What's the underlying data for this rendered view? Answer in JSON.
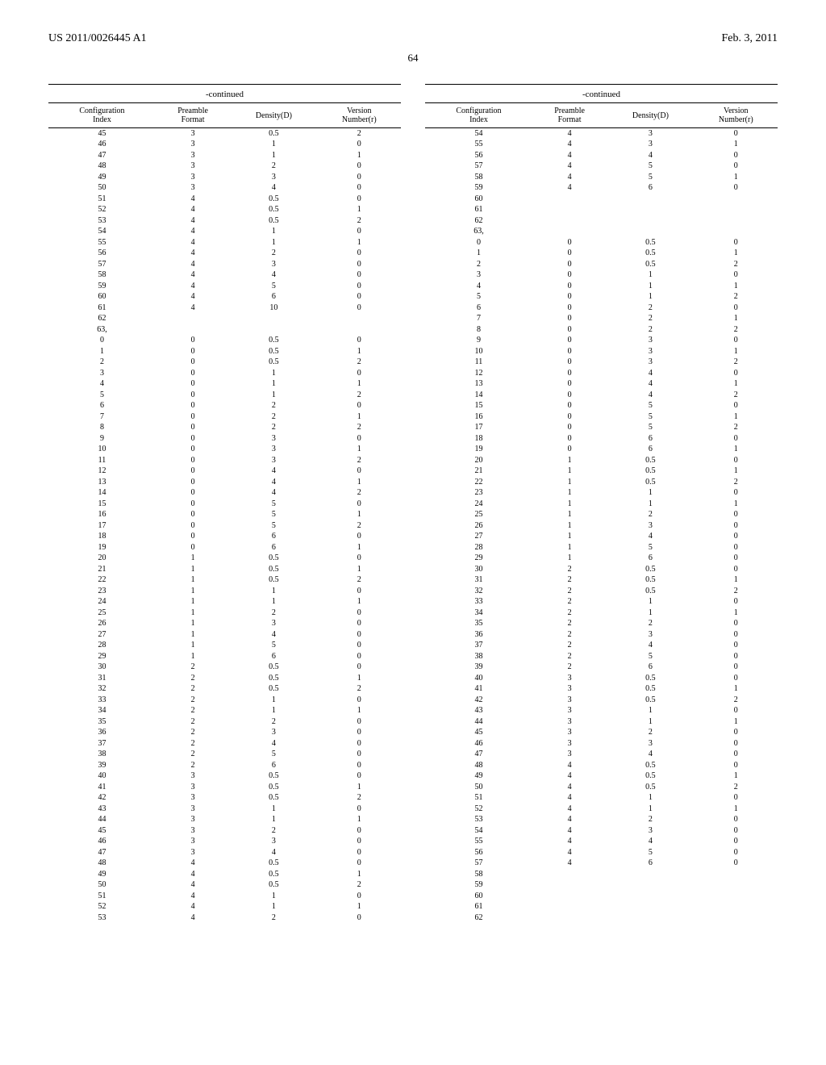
{
  "header": {
    "pub_number": "US 2011/0026445 A1",
    "pub_date": "Feb. 3, 2011",
    "page_number": "64"
  },
  "table": {
    "title": "-continued",
    "headers": [
      "Configuration\nIndex",
      "Preamble\nFormat",
      "Density(D)",
      "Version\nNumber(r)"
    ]
  },
  "left_rows": [
    [
      "45",
      "3",
      "0.5",
      "2"
    ],
    [
      "46",
      "3",
      "1",
      "0"
    ],
    [
      "47",
      "3",
      "1",
      "1"
    ],
    [
      "48",
      "3",
      "2",
      "0"
    ],
    [
      "49",
      "3",
      "3",
      "0"
    ],
    [
      "50",
      "3",
      "4",
      "0"
    ],
    [
      "51",
      "4",
      "0.5",
      "0"
    ],
    [
      "52",
      "4",
      "0.5",
      "1"
    ],
    [
      "53",
      "4",
      "0.5",
      "2"
    ],
    [
      "54",
      "4",
      "1",
      "0"
    ],
    [
      "55",
      "4",
      "1",
      "1"
    ],
    [
      "56",
      "4",
      "2",
      "0"
    ],
    [
      "57",
      "4",
      "3",
      "0"
    ],
    [
      "58",
      "4",
      "4",
      "0"
    ],
    [
      "59",
      "4",
      "5",
      "0"
    ],
    [
      "60",
      "4",
      "6",
      "0"
    ],
    [
      "61",
      "4",
      "10",
      "0"
    ],
    [
      "62",
      "",
      "",
      ""
    ],
    [
      "63,",
      "",
      "",
      ""
    ],
    [
      "0",
      "0",
      "0.5",
      "0"
    ],
    [
      "1",
      "0",
      "0.5",
      "1"
    ],
    [
      "2",
      "0",
      "0.5",
      "2"
    ],
    [
      "3",
      "0",
      "1",
      "0"
    ],
    [
      "4",
      "0",
      "1",
      "1"
    ],
    [
      "5",
      "0",
      "1",
      "2"
    ],
    [
      "6",
      "0",
      "2",
      "0"
    ],
    [
      "7",
      "0",
      "2",
      "1"
    ],
    [
      "8",
      "0",
      "2",
      "2"
    ],
    [
      "9",
      "0",
      "3",
      "0"
    ],
    [
      "10",
      "0",
      "3",
      "1"
    ],
    [
      "11",
      "0",
      "3",
      "2"
    ],
    [
      "12",
      "0",
      "4",
      "0"
    ],
    [
      "13",
      "0",
      "4",
      "1"
    ],
    [
      "14",
      "0",
      "4",
      "2"
    ],
    [
      "15",
      "0",
      "5",
      "0"
    ],
    [
      "16",
      "0",
      "5",
      "1"
    ],
    [
      "17",
      "0",
      "5",
      "2"
    ],
    [
      "18",
      "0",
      "6",
      "0"
    ],
    [
      "19",
      "0",
      "6",
      "1"
    ],
    [
      "20",
      "1",
      "0.5",
      "0"
    ],
    [
      "21",
      "1",
      "0.5",
      "1"
    ],
    [
      "22",
      "1",
      "0.5",
      "2"
    ],
    [
      "23",
      "1",
      "1",
      "0"
    ],
    [
      "24",
      "1",
      "1",
      "1"
    ],
    [
      "25",
      "1",
      "2",
      "0"
    ],
    [
      "26",
      "1",
      "3",
      "0"
    ],
    [
      "27",
      "1",
      "4",
      "0"
    ],
    [
      "28",
      "1",
      "5",
      "0"
    ],
    [
      "29",
      "1",
      "6",
      "0"
    ],
    [
      "30",
      "2",
      "0.5",
      "0"
    ],
    [
      "31",
      "2",
      "0.5",
      "1"
    ],
    [
      "32",
      "2",
      "0.5",
      "2"
    ],
    [
      "33",
      "2",
      "1",
      "0"
    ],
    [
      "34",
      "2",
      "1",
      "1"
    ],
    [
      "35",
      "2",
      "2",
      "0"
    ],
    [
      "36",
      "2",
      "3",
      "0"
    ],
    [
      "37",
      "2",
      "4",
      "0"
    ],
    [
      "38",
      "2",
      "5",
      "0"
    ],
    [
      "39",
      "2",
      "6",
      "0"
    ],
    [
      "40",
      "3",
      "0.5",
      "0"
    ],
    [
      "41",
      "3",
      "0.5",
      "1"
    ],
    [
      "42",
      "3",
      "0.5",
      "2"
    ],
    [
      "43",
      "3",
      "1",
      "0"
    ],
    [
      "44",
      "3",
      "1",
      "1"
    ],
    [
      "45",
      "3",
      "2",
      "0"
    ],
    [
      "46",
      "3",
      "3",
      "0"
    ],
    [
      "47",
      "3",
      "4",
      "0"
    ],
    [
      "48",
      "4",
      "0.5",
      "0"
    ],
    [
      "49",
      "4",
      "0.5",
      "1"
    ],
    [
      "50",
      "4",
      "0.5",
      "2"
    ],
    [
      "51",
      "4",
      "1",
      "0"
    ],
    [
      "52",
      "4",
      "1",
      "1"
    ],
    [
      "53",
      "4",
      "2",
      "0"
    ]
  ],
  "right_rows": [
    [
      "54",
      "4",
      "3",
      "0"
    ],
    [
      "55",
      "4",
      "3",
      "1"
    ],
    [
      "56",
      "4",
      "4",
      "0"
    ],
    [
      "57",
      "4",
      "5",
      "0"
    ],
    [
      "58",
      "4",
      "5",
      "1"
    ],
    [
      "59",
      "4",
      "6",
      "0"
    ],
    [
      "60",
      "",
      "",
      ""
    ],
    [
      "61",
      "",
      "",
      ""
    ],
    [
      "62",
      "",
      "",
      ""
    ],
    [
      "63,",
      "",
      "",
      ""
    ],
    [
      "0",
      "0",
      "0.5",
      "0"
    ],
    [
      "1",
      "0",
      "0.5",
      "1"
    ],
    [
      "2",
      "0",
      "0.5",
      "2"
    ],
    [
      "3",
      "0",
      "1",
      "0"
    ],
    [
      "4",
      "0",
      "1",
      "1"
    ],
    [
      "5",
      "0",
      "1",
      "2"
    ],
    [
      "6",
      "0",
      "2",
      "0"
    ],
    [
      "7",
      "0",
      "2",
      "1"
    ],
    [
      "8",
      "0",
      "2",
      "2"
    ],
    [
      "9",
      "0",
      "3",
      "0"
    ],
    [
      "10",
      "0",
      "3",
      "1"
    ],
    [
      "11",
      "0",
      "3",
      "2"
    ],
    [
      "12",
      "0",
      "4",
      "0"
    ],
    [
      "13",
      "0",
      "4",
      "1"
    ],
    [
      "14",
      "0",
      "4",
      "2"
    ],
    [
      "15",
      "0",
      "5",
      "0"
    ],
    [
      "16",
      "0",
      "5",
      "1"
    ],
    [
      "17",
      "0",
      "5",
      "2"
    ],
    [
      "18",
      "0",
      "6",
      "0"
    ],
    [
      "19",
      "0",
      "6",
      "1"
    ],
    [
      "20",
      "1",
      "0.5",
      "0"
    ],
    [
      "21",
      "1",
      "0.5",
      "1"
    ],
    [
      "22",
      "1",
      "0.5",
      "2"
    ],
    [
      "23",
      "1",
      "1",
      "0"
    ],
    [
      "24",
      "1",
      "1",
      "1"
    ],
    [
      "25",
      "1",
      "2",
      "0"
    ],
    [
      "26",
      "1",
      "3",
      "0"
    ],
    [
      "27",
      "1",
      "4",
      "0"
    ],
    [
      "28",
      "1",
      "5",
      "0"
    ],
    [
      "29",
      "1",
      "6",
      "0"
    ],
    [
      "30",
      "2",
      "0.5",
      "0"
    ],
    [
      "31",
      "2",
      "0.5",
      "1"
    ],
    [
      "32",
      "2",
      "0.5",
      "2"
    ],
    [
      "33",
      "2",
      "1",
      "0"
    ],
    [
      "34",
      "2",
      "1",
      "1"
    ],
    [
      "35",
      "2",
      "2",
      "0"
    ],
    [
      "36",
      "2",
      "3",
      "0"
    ],
    [
      "37",
      "2",
      "4",
      "0"
    ],
    [
      "38",
      "2",
      "5",
      "0"
    ],
    [
      "39",
      "2",
      "6",
      "0"
    ],
    [
      "40",
      "3",
      "0.5",
      "0"
    ],
    [
      "41",
      "3",
      "0.5",
      "1"
    ],
    [
      "42",
      "3",
      "0.5",
      "2"
    ],
    [
      "43",
      "3",
      "1",
      "0"
    ],
    [
      "44",
      "3",
      "1",
      "1"
    ],
    [
      "45",
      "3",
      "2",
      "0"
    ],
    [
      "46",
      "3",
      "3",
      "0"
    ],
    [
      "47",
      "3",
      "4",
      "0"
    ],
    [
      "48",
      "4",
      "0.5",
      "0"
    ],
    [
      "49",
      "4",
      "0.5",
      "1"
    ],
    [
      "50",
      "4",
      "0.5",
      "2"
    ],
    [
      "51",
      "4",
      "1",
      "0"
    ],
    [
      "52",
      "4",
      "1",
      "1"
    ],
    [
      "53",
      "4",
      "2",
      "0"
    ],
    [
      "54",
      "4",
      "3",
      "0"
    ],
    [
      "55",
      "4",
      "4",
      "0"
    ],
    [
      "56",
      "4",
      "5",
      "0"
    ],
    [
      "57",
      "4",
      "6",
      "0"
    ],
    [
      "58",
      "",
      "",
      ""
    ],
    [
      "59",
      "",
      "",
      ""
    ],
    [
      "60",
      "",
      "",
      ""
    ],
    [
      "61",
      "",
      "",
      ""
    ],
    [
      "62",
      "",
      "",
      ""
    ]
  ]
}
